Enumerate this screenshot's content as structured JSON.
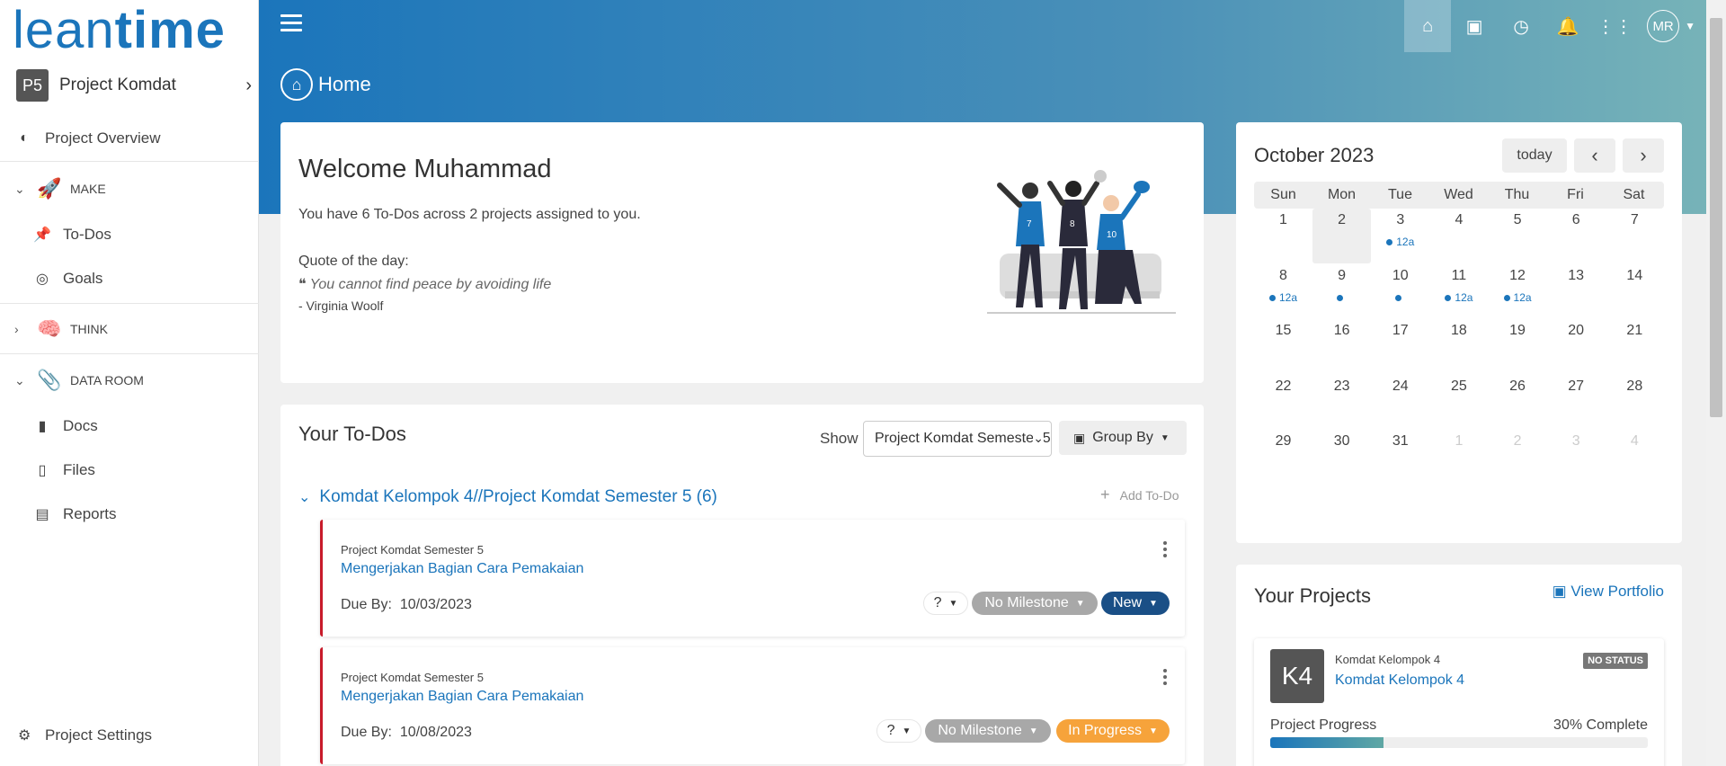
{
  "logo": {
    "light": "lean",
    "bold": "time"
  },
  "project": {
    "badge": "P5",
    "name": "Project Komdat"
  },
  "nav": {
    "overview": "Project Overview",
    "make": "MAKE",
    "todos": "To-Dos",
    "goals": "Goals",
    "think": "THINK",
    "dataroom": "DATA ROOM",
    "docs": "Docs",
    "files": "Files",
    "reports": "Reports",
    "settings": "Project Settings"
  },
  "header": {
    "page_title": "Home",
    "avatar": "MR"
  },
  "welcome": {
    "title": "Welcome Muhammad",
    "summary": "You have 6 To-Dos across 2 projects assigned to you.",
    "quote_label": "Quote of the day:",
    "quote": "You cannot find peace by avoiding life",
    "author": "- Virginia Woolf"
  },
  "todos": {
    "title": "Your To-Dos",
    "show_label": "Show",
    "show_value": "Project Komdat Semester 5",
    "group_by": "Group By",
    "group_title": "Komdat Kelompok 4//Project Komdat Semester 5 (6)",
    "add_todo": "Add To-Do",
    "due_label": "Due By:",
    "items": [
      {
        "project": "Project Komdat Semester 5",
        "title": "Mengerjakan Bagian Cara Pemakaian",
        "due": "10/03/2023",
        "priority": "?",
        "milestone": "No Milestone",
        "status": "New"
      },
      {
        "project": "Project Komdat Semester 5",
        "title": "Mengerjakan Bagian Cara Pemakaian",
        "due": "10/08/2023",
        "priority": "?",
        "milestone": "No Milestone",
        "status": "In Progress"
      }
    ]
  },
  "calendar": {
    "month": "October 2023",
    "today_btn": "today",
    "prev": "‹",
    "next": "›",
    "days_of_week": [
      "Sun",
      "Mon",
      "Tue",
      "Wed",
      "Thu",
      "Fri",
      "Sat"
    ],
    "weeks": [
      [
        "1",
        "2",
        "3",
        "4",
        "5",
        "6",
        "7"
      ],
      [
        "8",
        "9",
        "10",
        "11",
        "12",
        "13",
        "14"
      ],
      [
        "15",
        "16",
        "17",
        "18",
        "19",
        "20",
        "21"
      ],
      [
        "22",
        "23",
        "24",
        "25",
        "26",
        "27",
        "28"
      ],
      [
        "29",
        "30",
        "31",
        "1",
        "2",
        "3",
        "4"
      ]
    ],
    "event_label": "12a"
  },
  "projects": {
    "title": "Your Projects",
    "view_portfolio": "View Portfolio",
    "card": {
      "badge": "K4",
      "parent": "Komdat Kelompok 4",
      "name": "Komdat Kelompok 4",
      "status": "NO STATUS",
      "progress_label": "Project Progress",
      "progress_text": "30% Complete",
      "progress": 0.3
    }
  },
  "colors": {
    "accent": "#1b75bb",
    "status_new": "#1a4f86",
    "status_in_progress": "#f6a33b",
    "milestone": "#a8a8a8",
    "todo_border": "#c81b2a"
  }
}
